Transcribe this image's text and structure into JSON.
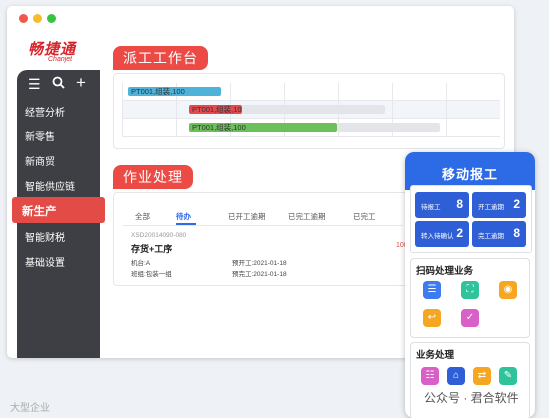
{
  "logo": {
    "name_cn": "畅捷通",
    "name_en": "Chanjet"
  },
  "sidebar": {
    "items": [
      {
        "label": "经营分析"
      },
      {
        "label": "新零售"
      },
      {
        "label": "新商贸"
      },
      {
        "label": "智能供应链"
      },
      {
        "label": "新生产"
      },
      {
        "label": "智能财税"
      },
      {
        "label": "基础设置"
      }
    ],
    "active_index": 4
  },
  "dispatch": {
    "title": "派工工作台",
    "bars": [
      {
        "label": "PT001,组装,100",
        "color": "#4fb3d9"
      },
      {
        "label": "PT001,组装,100",
        "color": "#e5484d"
      },
      {
        "label": "PT001,组装,100",
        "color": "#6cc05c"
      }
    ]
  },
  "work": {
    "title": "作业处理",
    "tabs": [
      "全部",
      "待办",
      "已开工逾期",
      "已完工逾期",
      "已完工"
    ],
    "active_tab": 1,
    "item": {
      "code": "XSD20014090-080",
      "name": "存货+工序",
      "qty": "100",
      "machine": "机台:A",
      "team": "班组:包装一组",
      "plan_start": "预开工:2021-01-18",
      "plan_finish": "预完工:2021-01-18"
    }
  },
  "mobile": {
    "title": "移动报工",
    "report_buttons": [
      {
        "label": "待报工",
        "count": "8"
      },
      {
        "label": "开工逾期",
        "count": "2"
      },
      {
        "label": "转入待确认",
        "count": "2"
      },
      {
        "label": "完工逾期",
        "count": "8"
      }
    ],
    "scan_section": "扫码处理业务",
    "biz_section": "业务处理",
    "colors": {
      "header": "#2d6be6",
      "button": "#2f5fd6"
    }
  },
  "watermark": {
    "left": "大型企业",
    "right": "公众号 · 君合软件"
  }
}
